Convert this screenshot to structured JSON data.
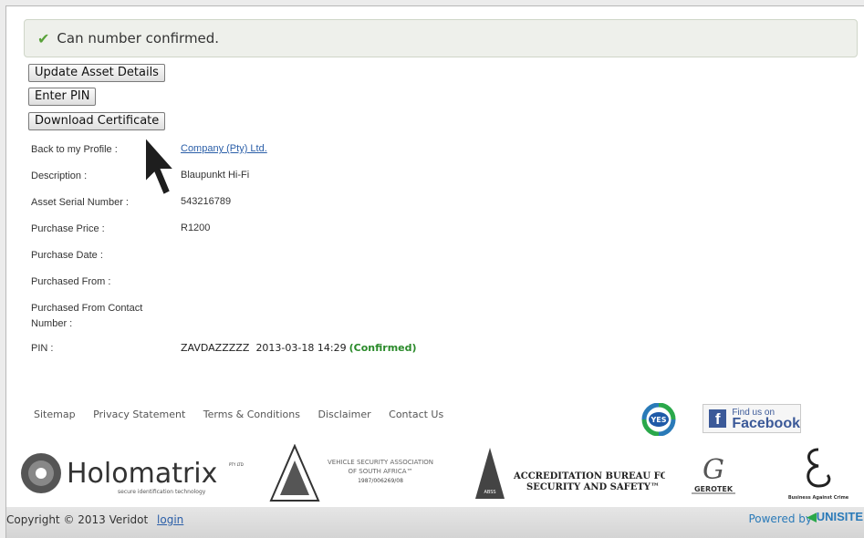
{
  "alert": {
    "icon": "checkmark-icon",
    "message": "Can number confirmed."
  },
  "buttons": {
    "update_asset": "Update Asset Details",
    "enter_pin": "Enter PIN",
    "download_certificate": "Download Certificate"
  },
  "details": [
    {
      "label": "Back to my Profile :",
      "value": "Company (Pty) Ltd."
    },
    {
      "label": "Description :",
      "value": "Blaupunkt Hi-Fi"
    },
    {
      "label": "Asset Serial Number :",
      "value": "543216789"
    },
    {
      "label": "Purchase Price :",
      "value": "R1200"
    },
    {
      "label": "Purchase Date :",
      "value": ""
    },
    {
      "label": "Purchased From :",
      "value": ""
    },
    {
      "label": "Purchased From Contact Number :",
      "value": ""
    }
  ],
  "pin": {
    "label": "PIN :",
    "value": "ZAVDAZZZZZ",
    "datetime": "2013-03-18 14:29",
    "status": "(Confirmed)"
  },
  "footer_links": [
    "Sitemap",
    "Privacy Statement",
    "Terms & Conditions",
    "Disclaimer",
    "Contact Us"
  ],
  "badges": {
    "yes": "YES",
    "facebook_small": "Find us on",
    "facebook_big": "Facebook"
  },
  "logos": {
    "holomatrix_name": "Holomatrix",
    "holomatrix_sub": "secure identification technology",
    "holomatrix_mark": "PTY LTD",
    "vesa_line1": "VEHICLE SECURITY ASSOCIATION",
    "vesa_line2": "OF SOUTH AFRICA™",
    "vesa_line3": "1987/006269/08",
    "vesa_tri": "VESA",
    "abss_line1": "ACCREDITATION BUREAU FOR",
    "abss_line2": "SECURITY AND SAFETY™",
    "abss_tri": "ABSS",
    "gerotek_name": "GEROTEK",
    "bac_name": "Business Against Crime"
  },
  "bottom": {
    "copyright": "Copyright © 2013 Veridot",
    "login": "login",
    "powered": "Powered by",
    "unisite": "UNISITE"
  },
  "colors": {
    "link": "#2a5ea8",
    "confirmed": "#2a8a2a",
    "alert_bg": "#eef0eb",
    "facebook": "#3b5998"
  }
}
